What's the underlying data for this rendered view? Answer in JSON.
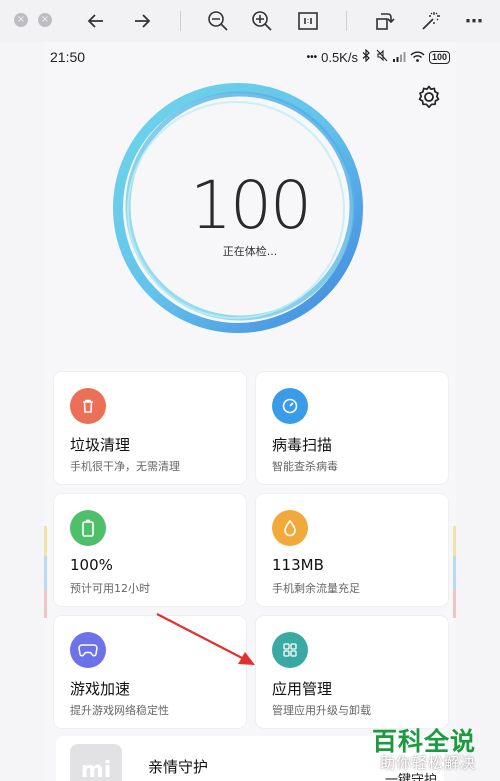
{
  "viewer": {
    "close_label": "×",
    "minimize_label": "×",
    "more_label": "⋯"
  },
  "status_bar": {
    "time": "21:50",
    "dots": "•••",
    "speed": "0.5K/s",
    "battery": "100"
  },
  "score": {
    "value": "100",
    "status": "正在体检..."
  },
  "cards": [
    {
      "title": "垃圾清理",
      "subtitle": "手机很干净，无需清理",
      "icon": "trash-icon",
      "color": "#ec6f57"
    },
    {
      "title": "病毒扫描",
      "subtitle": "智能查杀病毒",
      "icon": "scan-icon",
      "color": "#3a9be8"
    },
    {
      "title": "100%",
      "subtitle": "预计可用12小时",
      "icon": "battery-icon",
      "color": "#4fbf6a"
    },
    {
      "title": "113MB",
      "subtitle": "手机剩余流量充足",
      "icon": "data-icon",
      "color": "#f2a93b"
    },
    {
      "title": "游戏加速",
      "subtitle": "提升游戏网络稳定性",
      "icon": "gamepad-icon",
      "color": "#6d72e8"
    },
    {
      "title": "应用管理",
      "subtitle": "管理应用升级与卸载",
      "icon": "apps-icon",
      "color": "#3aa9a3"
    }
  ],
  "bottom": {
    "logo": "mi",
    "title": "亲情守护",
    "button": "一键守护"
  },
  "watermark": {
    "logo": "百科全说",
    "sub": "助你轻松解决"
  },
  "colors": {
    "ring_inner": "#7fd8e8",
    "ring_outer": "#4a8fe0",
    "arrow": "#e0312e"
  }
}
